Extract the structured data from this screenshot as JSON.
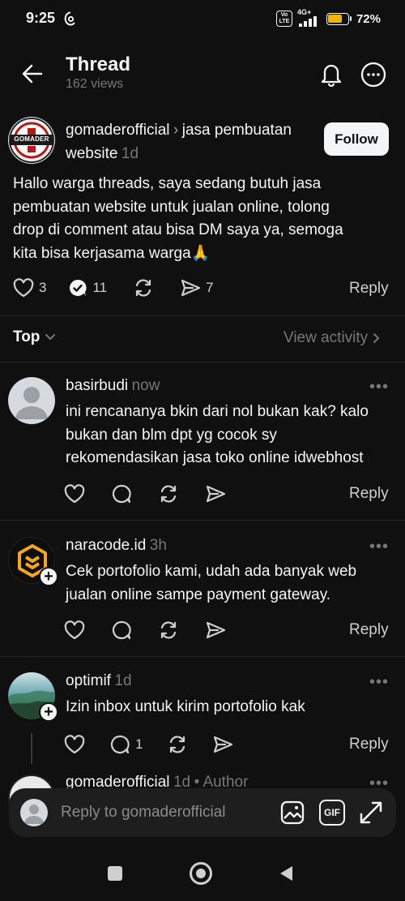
{
  "status_bar": {
    "time": "9:25",
    "volte": "Vo LTE",
    "network": "4G+",
    "battery": "72%"
  },
  "header": {
    "title": "Thread",
    "views": "162 views"
  },
  "post": {
    "username": "gomaderofficial",
    "topic": "jasa pembuatan",
    "topic_cont": "website",
    "time": "1d",
    "follow_label": "Follow",
    "avatar_text": "GOMADER",
    "lines": [
      "Hallo warga threads, saya sedang butuh jasa",
      "pembuatan website untuk jualan online, tolong",
      "drop di comment atau bisa DM saya ya, semoga",
      "kita bisa kerjasama warga🙏"
    ],
    "likes": "3",
    "comments": "11",
    "shares": "7",
    "reply_label": "Reply"
  },
  "sort": {
    "label": "Top",
    "view_activity": "View activity"
  },
  "comments": [
    {
      "username": "basirbudi",
      "time": "now",
      "lines": [
        "ini rencananya bkin dari nol bukan kak? kalo",
        "bukan dan blm dpt yg cocok sy",
        "rekomendasikan jasa toko online idwebhost"
      ],
      "reply_label": "Reply"
    },
    {
      "username": "naracode.id",
      "time": "3h",
      "lines": [
        "Cek portofolio kami, udah ada banyak web",
        "jualan online sampe payment gateway."
      ],
      "reply_label": "Reply"
    },
    {
      "username": "optimif",
      "time": "1d",
      "lines": [
        "Izin inbox  untuk kirim portofolio kak"
      ],
      "comment_count": "1",
      "reply_label": "Reply"
    },
    {
      "username": "gomaderofficial",
      "time": "1d",
      "author_tag": "• Author"
    }
  ],
  "composer": {
    "placeholder": "Reply to gomaderofficial",
    "gif_label": "GIF"
  },
  "colors": {
    "background": "#101010",
    "text": "#f3f5f7",
    "muted": "#777777",
    "divider": "#262626",
    "battery": "#f5b400"
  },
  "icons": [
    "back-arrow-icon",
    "bell-icon",
    "more-circle-icon",
    "heart-icon",
    "comment-icon",
    "repost-icon",
    "share-icon",
    "chevron-down-icon",
    "chevron-right-icon",
    "image-icon",
    "gif-icon",
    "expand-icon",
    "nav-square-icon",
    "nav-home-icon",
    "nav-back-icon"
  ]
}
